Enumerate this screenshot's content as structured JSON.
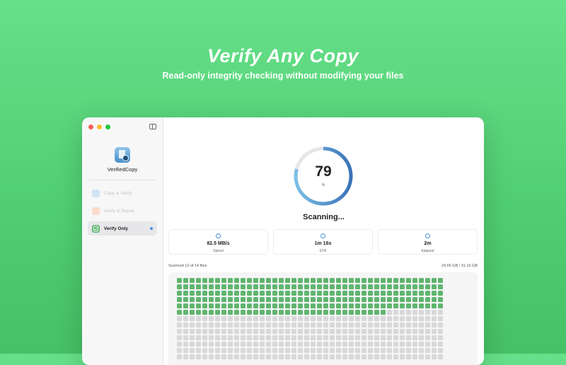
{
  "hero": {
    "title": "Verify Any Copy",
    "subtitle": "Read-only integrity checking without modifying your files"
  },
  "window": {
    "traffic_colors": [
      "#fe5f57",
      "#febc2e",
      "#28c840"
    ],
    "icon_names": [
      "sidebar-toggle-icon",
      "app-logo-icon",
      "gauge-icon",
      "clock-icon",
      "timer-icon",
      "shield-check-icon"
    ]
  },
  "sidebar": {
    "app_name": "VerifiedCopy",
    "items": [
      {
        "label": "Copy & Verify",
        "state": "disabled",
        "icon_color": "#cfe3f7"
      },
      {
        "label": "Verify & Repair",
        "state": "disabled",
        "icon_color": "#f9dccc"
      },
      {
        "label": "Verify Only",
        "state": "active",
        "icon_color": "#5fb56e"
      }
    ]
  },
  "progress": {
    "value": "79",
    "unit": "%",
    "fraction": 0.79,
    "status": "Scanning...",
    "ring_colors": {
      "track": "#e6e6e8",
      "start": "#7cc0e6",
      "end": "#3a72b8"
    }
  },
  "stats": [
    {
      "value": "82.5 MB/s",
      "label": "Speed"
    },
    {
      "value": "1m 16s",
      "label": "ETA"
    },
    {
      "value": "2m",
      "label": "Elapsed"
    }
  ],
  "files": {
    "scanned_text": "Scanned 12 of 14 files",
    "size_text": "24.65 GB / 31.16 GB",
    "columns": 42,
    "rows": 13,
    "done_cells": 243,
    "done_color": "#5fb56e",
    "pending_color": "#d8d8da"
  }
}
